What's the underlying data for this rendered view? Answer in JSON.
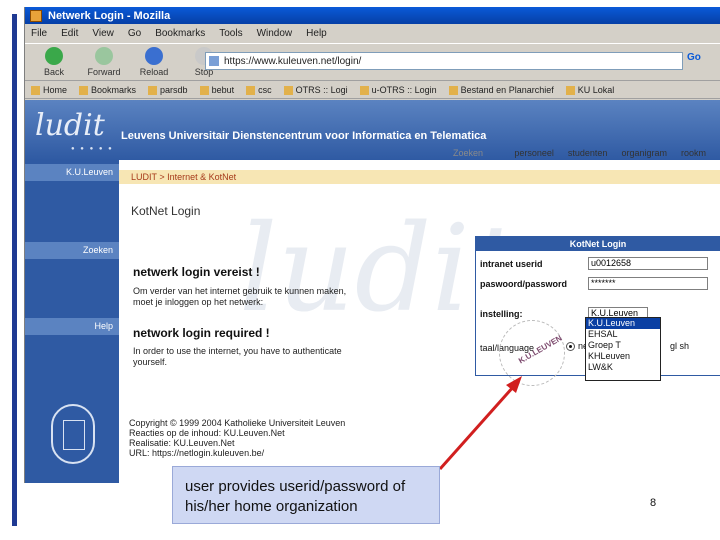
{
  "browser": {
    "title": "Netwerk Login - Mozilla",
    "menu": [
      "File",
      "Edit",
      "View",
      "Go",
      "Bookmarks",
      "Tools",
      "Window",
      "Help"
    ],
    "toolbar": {
      "back": "Back",
      "forward": "Forward",
      "reload": "Reload",
      "stop": "Stop"
    },
    "address": "https://www.kuleuven.net/login/",
    "go_label": "Go",
    "bookmarks": [
      "Home",
      "Bookmarks",
      "parsdb",
      "bebut",
      "csc",
      "OTRS :: Logi",
      "u-OTRS :: Login",
      "Bestand en Planarchief",
      "KU Lokal"
    ]
  },
  "page": {
    "logo": "ludit",
    "header_title": "Leuvens Universitair Dienstencentrum voor Informatica en Telematica",
    "nav": {
      "label": "Zoeken naar:",
      "items": [
        "personeel",
        "studenten",
        "organigram",
        "rookm"
      ]
    },
    "sidebar": {
      "kuleuven": "K.U.Leuven",
      "zoeken": "Zoeken",
      "help": "Help"
    },
    "breadcrumb": {
      "root": "LUDIT > Internet & KotNet",
      "current": ""
    },
    "title": "KotNet Login",
    "nl": {
      "heading": "netwerk login vereist !",
      "text": "Om verder van het internet gebruik te kunnen maken, moet je inloggen op het netwerk:"
    },
    "en": {
      "heading": "network login required !",
      "text": "In order to use the internet, you have to authenticate yourself."
    },
    "footer": [
      "Copyright © 1999 2004 Katholieke Universiteit Leuven",
      "Reacties op de inhoud: KU.Leuven.Net",
      "Realisatie: KU.Leuven.Net",
      "URL: https://netlogin.kuleuven.be/"
    ]
  },
  "login": {
    "heading": "KotNet Login",
    "userid_label": "intranet userid",
    "userid_value": "u0012658",
    "password_label": "paswoord/password",
    "password_value": "*******",
    "institution_label": "instelling:",
    "institution_value": "K.U.Leuven",
    "language_label": "taal/language",
    "language_nl": "ne",
    "language_en": "gl sh",
    "institution_options": [
      "K.U.Leuven",
      "EHSAL",
      "Groep T",
      "KHLeuven",
      "LW&K"
    ],
    "stamp_text": "K.U.LEUVEN"
  },
  "slide": {
    "callout": "user provides userid/password of his/her home organization",
    "number": "8",
    "arrow_color": "#d11f1f",
    "accent": "#2f5aa3"
  }
}
